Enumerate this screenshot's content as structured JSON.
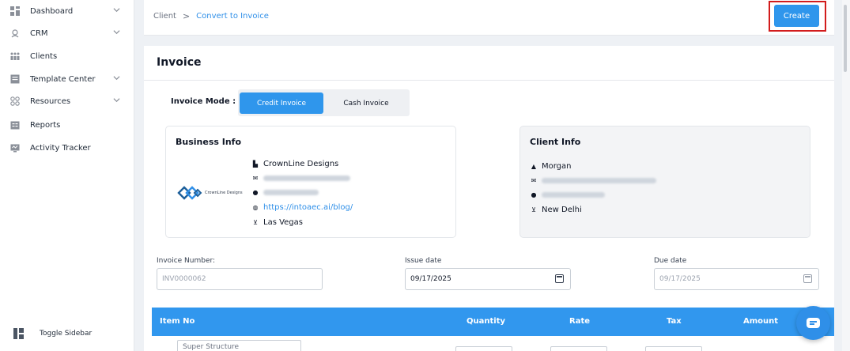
{
  "sidebar": {
    "items": [
      {
        "label": "Dashboard",
        "icon": "grid-icon",
        "has_chevron": true
      },
      {
        "label": "CRM",
        "icon": "headset-icon",
        "has_chevron": true
      },
      {
        "label": "Clients",
        "icon": "users-icon",
        "has_chevron": false
      },
      {
        "label": "Template Center",
        "icon": "template-icon",
        "has_chevron": true
      },
      {
        "label": "Resources",
        "icon": "resources-icon",
        "has_chevron": true
      },
      {
        "label": "Reports",
        "icon": "reports-icon",
        "has_chevron": false
      },
      {
        "label": "Activity Tracker",
        "icon": "monitor-icon",
        "has_chevron": false
      }
    ],
    "toggle_label": "Toggle Sidebar"
  },
  "breadcrumb": {
    "root": "Client",
    "separator": ">",
    "current": "Convert to Invoice"
  },
  "toolbar": {
    "create_label": "Create"
  },
  "invoice": {
    "title": "Invoice",
    "mode_label": "Invoice Mode :",
    "modes": {
      "credit": "Credit Invoice",
      "cash": "Cash Invoice",
      "selected": "Credit Invoice"
    }
  },
  "business": {
    "title": "Business Info",
    "logo_text": "CrownLine Designs",
    "name": "CrownLine Designs",
    "website": "https://intoaec.ai/blog/",
    "location": "Las Vegas"
  },
  "client": {
    "title": "Client Info",
    "name": "Morgan",
    "location": "New Delhi"
  },
  "fields": {
    "invoice_number": {
      "label": "Invoice Number:",
      "placeholder": "INV0000062"
    },
    "issue_date": {
      "label": "Issue date",
      "value": "09/17/2025"
    },
    "due_date": {
      "label": "Due date",
      "placeholder": "09/17/2025"
    }
  },
  "table": {
    "headers": {
      "item_no": "Item No",
      "quantity": "Quantity",
      "rate": "Rate",
      "tax": "Tax",
      "amount": "Amount"
    },
    "first_row_item": "Super Structure"
  },
  "colors": {
    "accent": "#2f96ec",
    "highlight": "#d21c1c",
    "table_header": "#3197ee"
  }
}
